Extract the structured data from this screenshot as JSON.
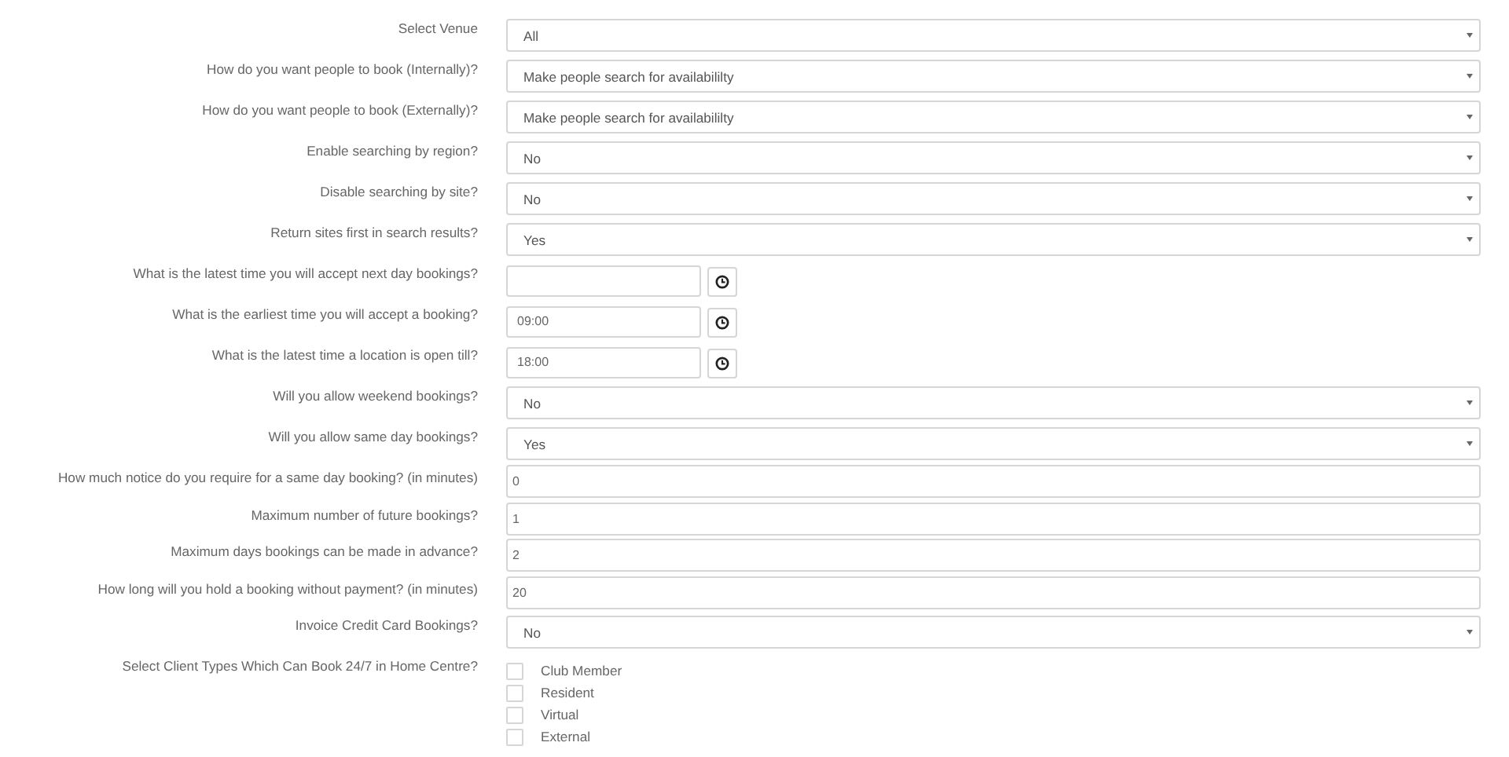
{
  "fields": [
    {
      "kind": "select",
      "label": "Select Venue",
      "value": "All"
    },
    {
      "kind": "select",
      "label": "How do you want people to book (Internally)?",
      "value": "Make people search for availabililty"
    },
    {
      "kind": "select",
      "label": "How do you want people to book (Externally)?",
      "value": "Make people search for availabililty"
    },
    {
      "kind": "select",
      "label": "Enable searching by region?",
      "value": "No"
    },
    {
      "kind": "select",
      "label": "Disable searching by site?",
      "value": "No"
    },
    {
      "kind": "select",
      "label": "Return sites first in search results?",
      "value": "Yes"
    },
    {
      "kind": "time",
      "label": "What is the latest time you will accept next day bookings?"
    },
    {
      "kind": "time",
      "label": "What is the earliest time you will accept a booking?",
      "value": "09:00"
    },
    {
      "kind": "time",
      "label": "What is the latest time a location is open till?",
      "value": "18:00"
    },
    {
      "kind": "select",
      "label": "Will you allow weekend bookings?",
      "value": "No"
    },
    {
      "kind": "select",
      "label": "Will you allow same day bookings?",
      "value": "Yes"
    },
    {
      "kind": "text",
      "label": "How much notice do you require for a same day booking? (in minutes)",
      "value": "0"
    },
    {
      "kind": "text",
      "label": "Maximum number of future bookings?",
      "value": "1"
    },
    {
      "kind": "text",
      "label": "Maximum days bookings can be made in advance?",
      "value": "2"
    },
    {
      "kind": "text",
      "label": "How long will you hold a booking without payment? (in minutes)",
      "value": "20"
    },
    {
      "kind": "select",
      "label": "Invoice Credit Card Bookings?",
      "value": "No"
    },
    {
      "kind": "checkboxes",
      "label": "Select Client Types Which Can Book 24/7 in Home Centre?",
      "options": [
        {
          "label": "Club Member",
          "checked": false
        },
        {
          "label": "Resident",
          "checked": false
        },
        {
          "label": "Virtual",
          "checked": false
        },
        {
          "label": "External",
          "checked": false
        }
      ]
    }
  ]
}
